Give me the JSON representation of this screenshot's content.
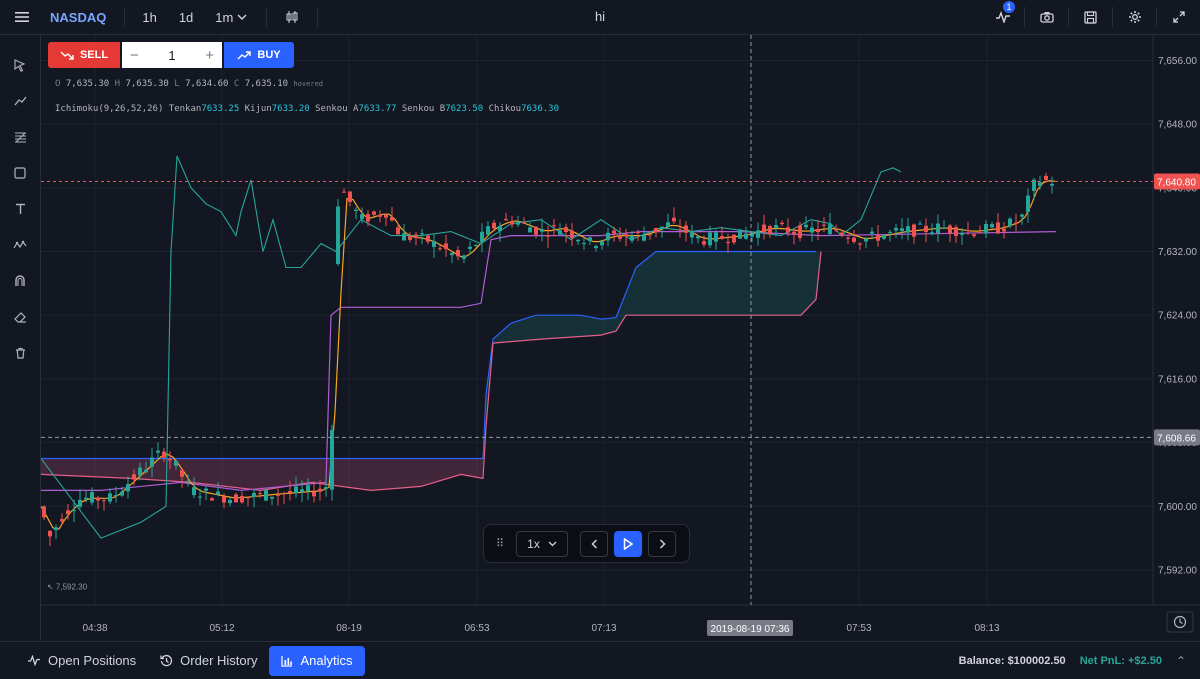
{
  "toolbar": {
    "symbol": "NASDAQ",
    "timeframes": [
      "1h",
      "1d",
      "1m"
    ],
    "title": "hi",
    "alerts_badge": "1"
  },
  "trade": {
    "sell_label": "SELL",
    "buy_label": "BUY",
    "quantity": "1",
    "minus": "−",
    "plus": "+"
  },
  "ohlc": {
    "o_label": "O",
    "o": "7,635.30",
    "h_label": "H",
    "h": "7,635.30",
    "l_label": "L",
    "l": "7,634.60",
    "c_label": "C",
    "c": "7,635.10",
    "tag": "hovered"
  },
  "indicator": {
    "name": "Ichimoku(9,26,52,26)",
    "tenkan_label": "Tenkan",
    "tenkan": "7633.25",
    "kijun_label": "Kijun",
    "kijun": "7633.20",
    "senkou_a_label": "Senkou A",
    "senkou_a": "7633.77",
    "senkou_b_label": "Senkou B",
    "senkou_b": "7623.50",
    "chikou_label": "Chikou",
    "chikou": "7636.30"
  },
  "chart_data": {
    "type": "candlestick",
    "y_ticks": [
      "7,656.00",
      "7,648.00",
      "7,640.00",
      "7,632.00",
      "7,624.00",
      "7,616.00",
      "7,608.00",
      "7,600.00",
      "7,592.00"
    ],
    "y_values": [
      7656,
      7648,
      7640,
      7632,
      7624,
      7616,
      7608,
      7600,
      7592
    ],
    "x_ticks": [
      "04:38",
      "05:12",
      "08-19",
      "06:53",
      "07:13",
      "07:53",
      "08:13"
    ],
    "ylim": [
      7587.6,
      7659.2
    ],
    "last_price": 7640.8,
    "last_price_label": "7,640.80",
    "crosshair_price": 7608.66,
    "crosshair_price_label": "7,608.66",
    "crosshair_time_label": "2019-08-19 07:36",
    "low_marker": "↖ 7,592.30",
    "colors": {
      "up": "#26a69a",
      "down": "#ef5350",
      "tenkan": "#f5a623",
      "kijun": "#b05dd6",
      "chikou": "#26a69a",
      "senkou_a": "#2962ff",
      "senkou_b": "#e55f8a"
    }
  },
  "replay": {
    "speed": "1x"
  },
  "bottom": {
    "tabs": [
      "Open Positions",
      "Order History",
      "Analytics"
    ],
    "balance_label": "Balance:",
    "balance": "$100002.50",
    "pnl_label": "Net PnL:",
    "pnl": "+$2.50"
  }
}
